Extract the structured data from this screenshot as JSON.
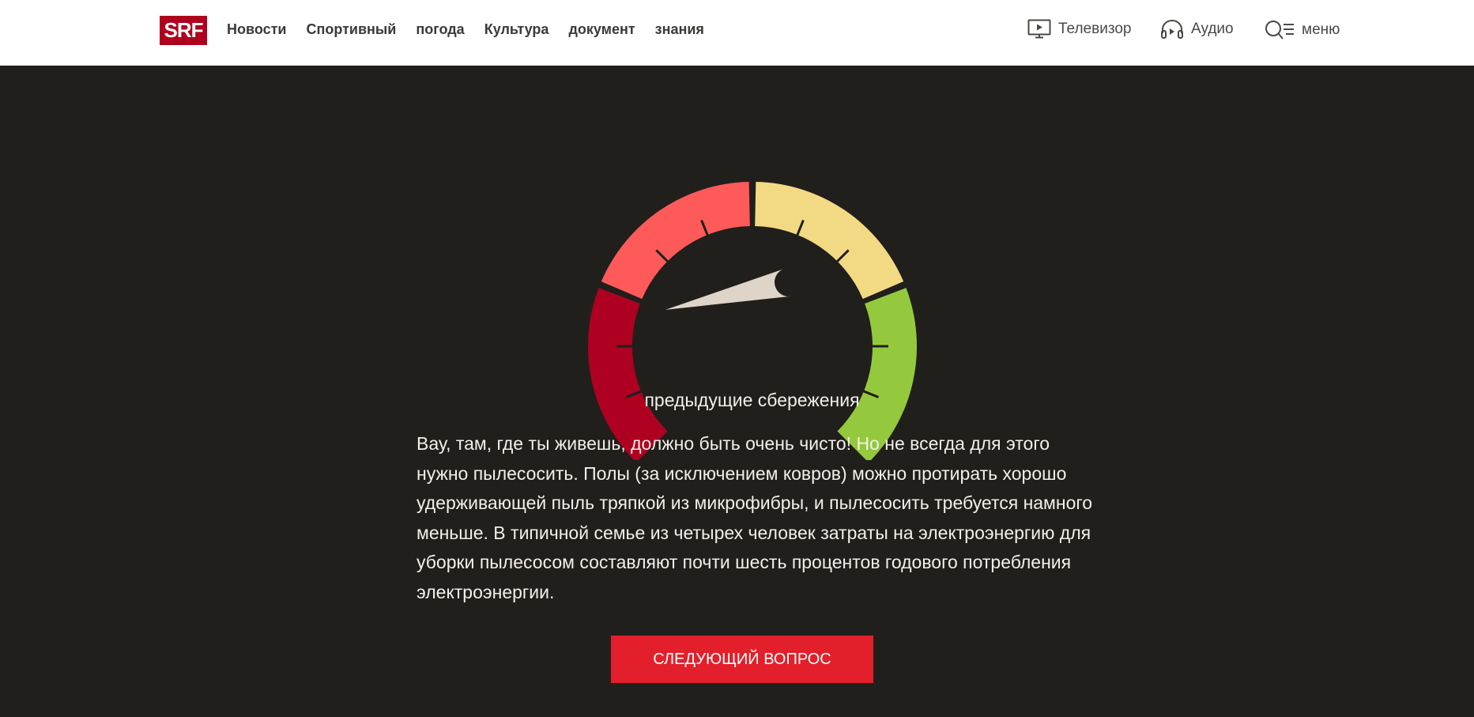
{
  "header": {
    "logo_text": "SRF",
    "brand_color": "#af001e",
    "nav": [
      {
        "label": "Новости"
      },
      {
        "label": "Спортивный"
      },
      {
        "label": "погода"
      },
      {
        "label": "Культура"
      },
      {
        "label": "документ"
      },
      {
        "label": "знания"
      }
    ],
    "utilities": {
      "tv_label": "Телевизор",
      "audio_label": "Аудио",
      "menu_label": "меню"
    }
  },
  "gauge": {
    "label": "предыдущие сбережения",
    "value_fraction": 0.12,
    "segment_colors": [
      "#ae0021",
      "#ff5a5a",
      "#f2d983",
      "#95c93d"
    ],
    "needle_color": "#ded4c7"
  },
  "content": {
    "text": "Вау, там, где ты живешь, должно быть очень чисто! Но не всегда для этого нужно пылесосить. Полы (за исключением ковров) можно протирать хорошо удерживающей пыль тряпкой из микрофибры, и пылесосить требуется намного меньше. В типичной семье из четырех человек затраты на электроэнергию для уборки пылесосом составляют почти шесть процентов годового потребления электроэнергии."
  },
  "actions": {
    "next_label": "СЛЕДУЮЩИЙ ВОПРОС",
    "accent": "#e31f2b"
  }
}
